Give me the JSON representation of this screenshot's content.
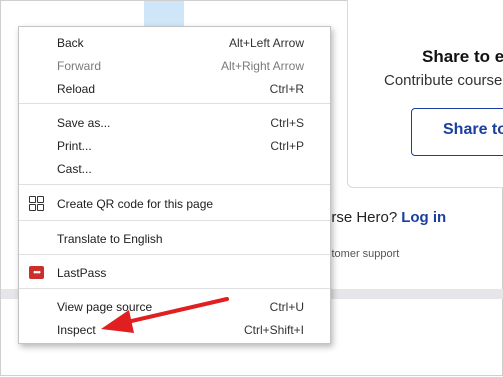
{
  "background": {
    "card_title": "Share to ea",
    "card_subtitle": "Contribute course",
    "card_button": "Share to",
    "login_text": "urse Hero?",
    "login_link": "Log in",
    "support_text": "stomer support"
  },
  "context_menu": {
    "groups": [
      [
        {
          "label": "Back",
          "shortcut": "Alt+Left Arrow",
          "enabled": true
        },
        {
          "label": "Forward",
          "shortcut": "Alt+Right Arrow",
          "enabled": false
        },
        {
          "label": "Reload",
          "shortcut": "Ctrl+R",
          "enabled": true
        }
      ],
      [
        {
          "label": "Save as...",
          "shortcut": "Ctrl+S",
          "enabled": true
        },
        {
          "label": "Print...",
          "shortcut": "Ctrl+P",
          "enabled": true
        },
        {
          "label": "Cast...",
          "shortcut": "",
          "enabled": true
        }
      ],
      [
        {
          "label": "Create QR code for this page",
          "shortcut": "",
          "icon": "qr-code-icon",
          "enabled": true
        }
      ],
      [
        {
          "label": "Translate to English",
          "shortcut": "",
          "enabled": true
        }
      ],
      [
        {
          "label": "LastPass",
          "shortcut": "",
          "icon": "lastpass-icon",
          "enabled": true
        }
      ],
      [
        {
          "label": "View page source",
          "shortcut": "Ctrl+U",
          "enabled": true
        },
        {
          "label": "Inspect",
          "shortcut": "Ctrl+Shift+I",
          "enabled": true
        }
      ]
    ]
  },
  "icons": {
    "lastpass_glyph": "•••"
  },
  "colors": {
    "link_blue": "#1a3f9e",
    "arrow_red": "#e02020",
    "lastpass_red": "#cc2d2d",
    "illustration_blue": "#cfe6f8"
  }
}
